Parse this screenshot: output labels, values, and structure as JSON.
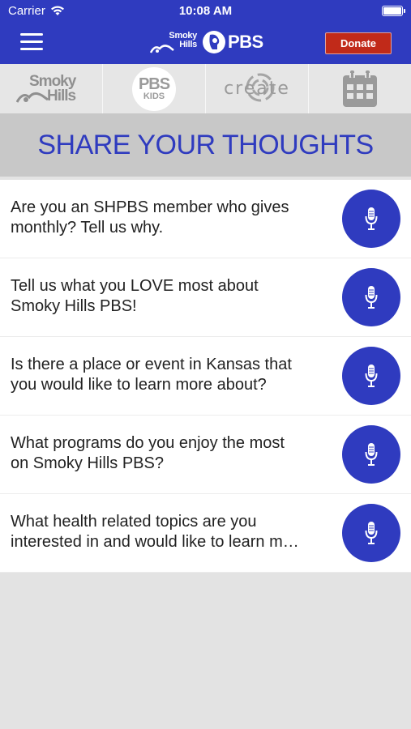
{
  "status_bar": {
    "carrier": "Carrier",
    "time": "10:08 AM"
  },
  "header": {
    "logo_small_line1": "Smoky",
    "logo_small_line2": "Hills",
    "logo_pbs": "PBS",
    "donate_label": "Donate",
    "background_color": "#2f3bbf",
    "donate_color": "#c12a19"
  },
  "stations": [
    {
      "name": "Smoky Hills",
      "line1": "Smoky",
      "line2": "Hills"
    },
    {
      "name": "PBS Kids",
      "line1": "PBS",
      "line2": "KIDS"
    },
    {
      "name": "create",
      "text": "create"
    },
    {
      "name": "calendar-icon"
    }
  ],
  "page": {
    "title": "SHARE YOUR THOUGHTS"
  },
  "questions": [
    {
      "line1": "Are you an SHPBS member who gives",
      "line2": "monthly? Tell us why.",
      "icon": "microphone-icon"
    },
    {
      "line1": "Tell us what you LOVE most about",
      "line2": "Smoky Hills PBS!",
      "icon": "microphone-icon"
    },
    {
      "line1": "Is there a place or event in Kansas that",
      "line2": "you would like to learn more about?",
      "icon": "microphone-icon"
    },
    {
      "line1": "What programs do you enjoy the most",
      "line2": "on Smoky Hills PBS?",
      "icon": "microphone-icon"
    },
    {
      "line1": "What health related topics are you",
      "line2": "interested in and would like to learn m…",
      "icon": "microphone-icon"
    }
  ],
  "colors": {
    "accent": "#2f3bbf",
    "title_band": "#c8c8c8",
    "background": "#e3e3e3"
  }
}
